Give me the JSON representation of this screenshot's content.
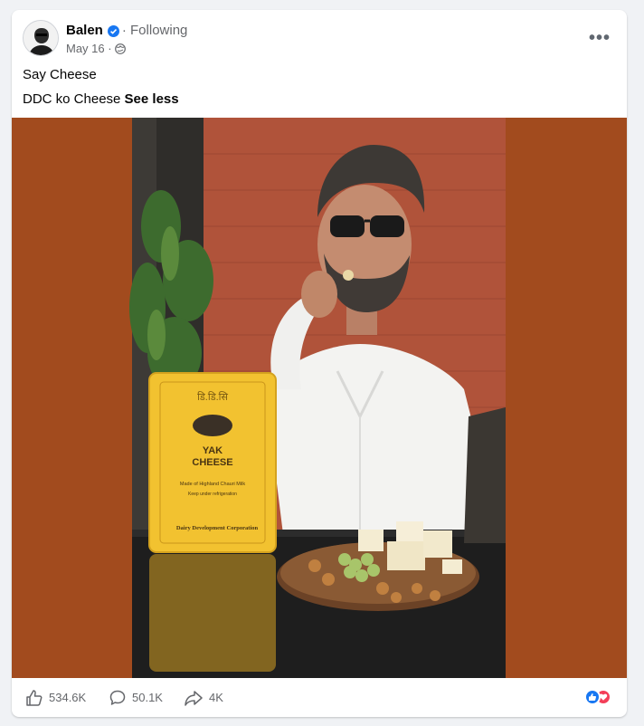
{
  "post": {
    "author": "Balen",
    "follow_status": "· Following",
    "date": "May 16 ·",
    "caption_line1": "Say Cheese",
    "caption_line2": "DDC ko Cheese ",
    "see_less": "See less",
    "more_icon": "more-horizontal-icon",
    "verified_icon": "verified-badge-icon",
    "privacy_icon": "globe-icon"
  },
  "photo": {
    "product_brand_np": "डि.डि.सि",
    "product_name_1": "YAK",
    "product_name_2": "CHEESE",
    "product_subtitle": "Made of Highland Chauri Milk",
    "product_note": "Keep under refrigeration",
    "product_maker": "Dairy Development Corporation"
  },
  "stats": {
    "likes": "534.6K",
    "comments": "50.1K",
    "shares": "4K"
  },
  "colors": {
    "media_bg": "#a24b1e",
    "accent": "#1877f2",
    "love": "#f33e58"
  }
}
